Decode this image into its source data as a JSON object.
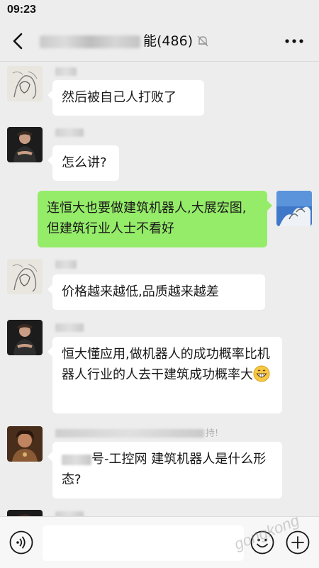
{
  "status_bar": {
    "time": "09:23"
  },
  "header": {
    "title_suffix": "能(486)",
    "icons": {
      "back": "chevron-left-icon",
      "mute": "bell-off-icon",
      "more": "more-dots-icon"
    }
  },
  "messages": [
    {
      "side": "in",
      "avatar": "sketch",
      "text": "然后被自己人打败了"
    },
    {
      "side": "in",
      "avatar": "man-dark",
      "text": "怎么讲?"
    },
    {
      "side": "out",
      "avatar": "tree-snow",
      "text": "连恒大也要做建筑机器人,大展宏图,但建筑行业人士不看好"
    },
    {
      "side": "in",
      "avatar": "sketch",
      "text": "价格越来越低,品质越来越差"
    },
    {
      "side": "in",
      "avatar": "man-dark",
      "text": "恒大懂应用,做机器人的成功概率比机器人行业的人去干建筑成功概率大"
    },
    {
      "side": "in",
      "avatar": "woman-portrait",
      "mention_suffix": "号-工控网",
      "text": "建筑机器人是什么形态?"
    }
  ],
  "nick_fragments": {
    "msg6_tail": "持!"
  },
  "input": {
    "placeholder": ""
  },
  "watermark": "gongkong",
  "colors": {
    "incoming_bubble": "#ffffff",
    "outgoing_bubble": "#95ec69",
    "background": "#ededed"
  }
}
